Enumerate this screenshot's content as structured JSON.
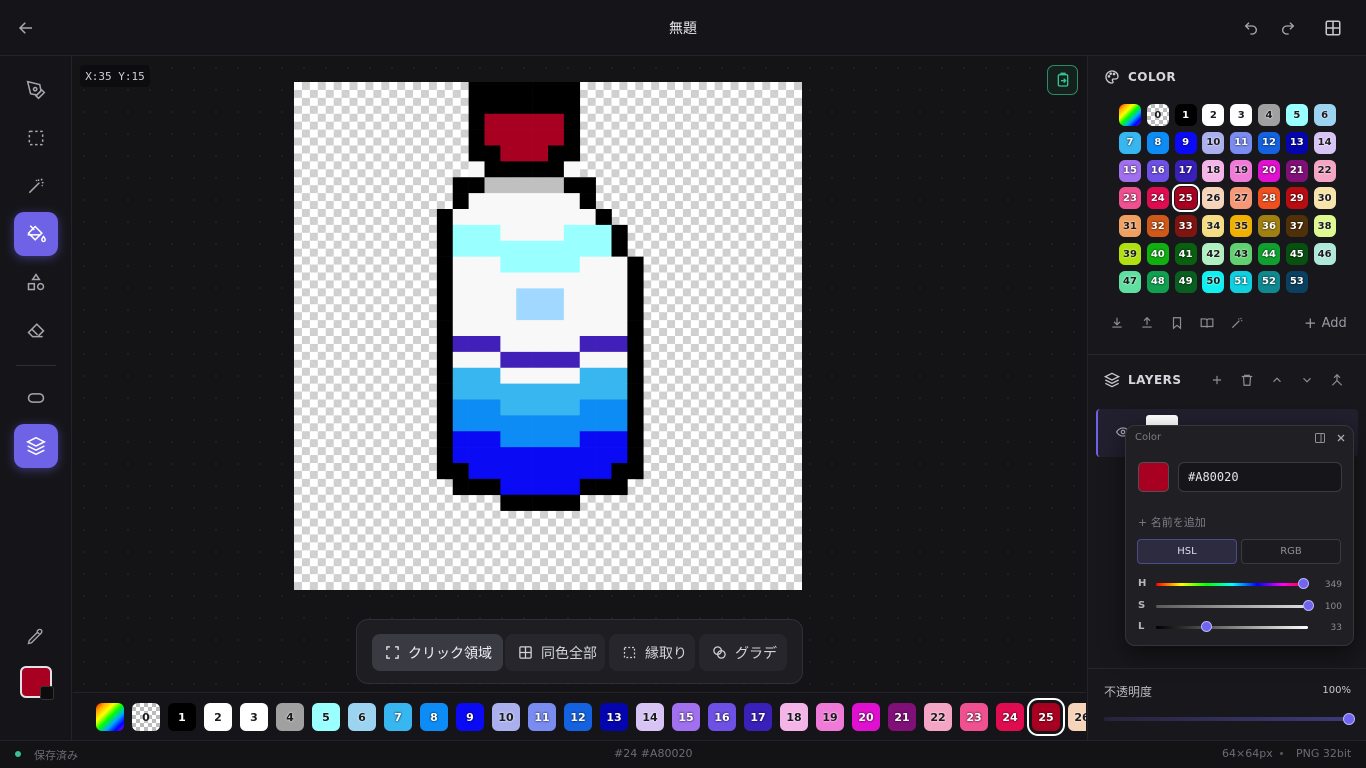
{
  "header": {
    "title": "無題",
    "back_icon": "arrow-left-icon",
    "undo_icon": "undo-icon",
    "redo_icon": "redo-icon",
    "layout_icon": "grid-layout-icon"
  },
  "tools": [
    {
      "name": "pen-tool",
      "icon": "pen-icon",
      "active": false
    },
    {
      "name": "select-tool",
      "icon": "dashed-square-icon",
      "active": false
    },
    {
      "name": "magic-wand-tool",
      "icon": "magic-wand-icon",
      "active": false
    },
    {
      "name": "fill-tool",
      "icon": "paint-bucket-icon",
      "active": true
    },
    {
      "name": "shapes-tool",
      "icon": "shapes-icon",
      "active": false
    },
    {
      "name": "eraser-tool",
      "icon": "eraser-icon",
      "active": false
    },
    {
      "name": "ellipse-tool",
      "icon": "ellipse-icon",
      "active": false
    },
    {
      "name": "layers-tool",
      "icon": "layers-icon",
      "active": true
    }
  ],
  "cursor": {
    "coords": "X:35 Y:15"
  },
  "fill_modes": [
    {
      "label": "クリック領域",
      "icon": "expand-icon",
      "active": true
    },
    {
      "label": "同色全部",
      "icon": "grid-icon",
      "active": false
    },
    {
      "label": "縁取り",
      "icon": "dashed-square-icon",
      "active": false
    },
    {
      "label": "グラデ",
      "icon": "gradient-icon",
      "active": false
    }
  ],
  "palette": {
    "colors": [
      "transparent",
      "#000000",
      "#ffffff",
      "#ffffff",
      "#a0a0a0",
      "#99ffff",
      "#9cd3f0",
      "#38b6f0",
      "#0e8cf5",
      "#0a0af5",
      "#aab0ee",
      "#7a8cf0",
      "#1462e0",
      "#0505b0",
      "#d8c4f4",
      "#a070ef",
      "#6e50e5",
      "#3820b8",
      "#f4b4e8",
      "#f07ad8",
      "#e010d0",
      "#801078",
      "#f4a4c4",
      "#ef5090",
      "#e00c50",
      "#a80020",
      "#f6d4ba",
      "#f49878",
      "#f05020",
      "#b80c10",
      "#f6e4aa",
      "#f0a060",
      "#d05818",
      "#801410",
      "#f4dc84",
      "#f0b000",
      "#a08010",
      "#503008",
      "#e0f890",
      "#b0e010",
      "#10b010",
      "#086010",
      "#b0f0c0",
      "#60d070",
      "#10a030",
      "#085010",
      "#b0e8d8",
      "#60e0a0",
      "#10a050",
      "#086020",
      "#10f0f0",
      "#10d0e0",
      "#108890",
      "#0a4060"
    ],
    "selected": 25,
    "rainbow_icon": "rainbow-swatch-icon"
  },
  "panel": {
    "color_title": "COLOR",
    "layers_title": "LAYERS",
    "add_label": "Add",
    "palette_icons": [
      "download-icon",
      "upload-icon",
      "bookmark-icon",
      "book-icon",
      "magic-wand-icon"
    ],
    "layer_icons": [
      "plus-icon",
      "trash-icon",
      "chevron-up-icon",
      "chevron-down-icon",
      "merge-icon"
    ]
  },
  "color_popup": {
    "title": "Color",
    "hex": "#A80020",
    "name_placeholder": "+ 名前を追加",
    "mode_hsl": "HSL",
    "mode_rgb": "RGB",
    "h_label": "H",
    "h": 349,
    "s_label": "S",
    "s": 100,
    "l_label": "L",
    "l": 33
  },
  "opacity": {
    "label": "不透明度",
    "value": "100%",
    "level": 1.0
  },
  "status": {
    "saved": "保存済み",
    "color_info": "#24 #A80020",
    "size": "64×64px",
    "format": "PNG 32bit"
  },
  "current_color": "#A80020",
  "sprite": {
    "palette": {
      "K": "#000000",
      "R": "#A80020",
      "G": "#c0c0c0",
      "W": "#f8f8f8",
      "C": "#99ffff",
      "V": "#4020b8",
      "L": "#38b6f0",
      "A": "#0e8cf5",
      "B": "#0a0af5",
      "P": "#a0d8ff"
    },
    "rows": [
      "...........KKKKKKK.............",
      "...........KKKKKKK.............",
      "...........KRRRRRK.............",
      "...........KRRRRRK.............",
      "...........KKRRRKK.............",
      "...........WKKKKKW.............",
      "..........KKGGGGGKK............",
      "..........KWWWWWWWK............",
      ".........KWWWWWWWWWK...........",
      ".........KCCCWWWWCCCK..........",
      ".........KCCCCCCCCCCK..........",
      ".........KWWWCCCCCWWWK.........",
      ".........KWWWWWWWWWWWK.........",
      ".........KWWWWPPPWWWWK.........",
      ".........KWWWWPPPWWWWK.........",
      ".........KWWWWWWWWWWWK.........",
      ".........KVVVWWWWWVVVK.........",
      ".........KWWWVVVVVWWWK.........",
      ".........KLLLWWWWWLLLK.........",
      ".........KLLLLLLLLLLLK.........",
      ".........KAAALLLLLAAAK.........",
      ".........KAAAAAAAAAAAK.........",
      ".........KBBBAAAAABBBK.........",
      ".........KBBBBBBBBBBBK.........",
      ".........KKBBBBBBBBBKK.........",
      "..........KKKBBBBBKKK..........",
      ".............KKKKK............."
    ]
  }
}
